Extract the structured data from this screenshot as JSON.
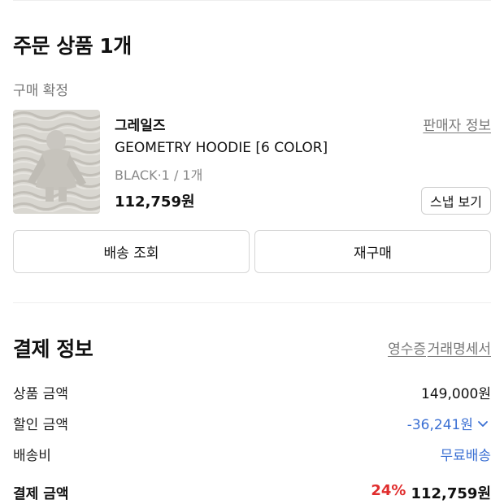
{
  "order": {
    "title": "주문 상품 1개",
    "status": "구매 확정",
    "item": {
      "brand": "그레일즈",
      "seller_link": "판매자 정보",
      "name": "GEOMETRY HOODIE [6 COLOR]",
      "option": "BLACK·1 / 1개",
      "price": "112,759원",
      "snap_label": "스냅 보기"
    },
    "shipping_button": "배송 조회",
    "rebuy_button": "재구매"
  },
  "payment": {
    "title": "결제 정보",
    "receipt_link": "영수증",
    "statement_link": "거래명세서",
    "rows": [
      {
        "label": "상품 금액",
        "value": "149,000원"
      },
      {
        "label": "할인 금액",
        "value": "-36,241원"
      },
      {
        "label": "배송비",
        "value": "무료배송"
      }
    ],
    "total_label": "결제 금액",
    "discount_rate": "24%",
    "total_value": "112,759원"
  },
  "colors": {
    "link_blue": "#3a6fd3",
    "discount_red": "#e02d2d",
    "muted_text": "#777777"
  }
}
